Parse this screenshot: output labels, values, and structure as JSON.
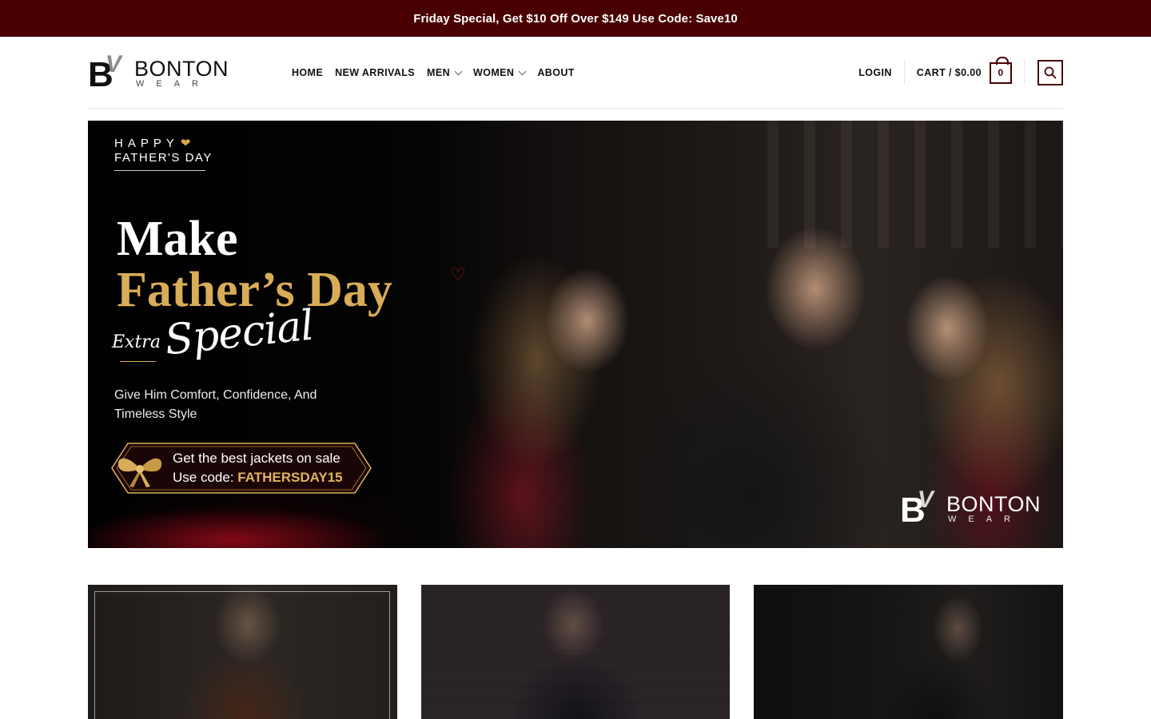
{
  "announcement": {
    "text": "Friday Special, Get $10 Off Over $149 Use Code: Save10"
  },
  "brand": {
    "word": "BONTON",
    "subword": "WEAR",
    "mark_b": "B",
    "mark_v": "V"
  },
  "nav": {
    "items": [
      {
        "label": "HOME",
        "has_dropdown": false
      },
      {
        "label": "NEW ARRIVALS",
        "has_dropdown": false
      },
      {
        "label": "MEN",
        "has_dropdown": true
      },
      {
        "label": "WOMEN",
        "has_dropdown": true
      },
      {
        "label": "ABOUT",
        "has_dropdown": false
      }
    ]
  },
  "header_right": {
    "login_label": "LOGIN",
    "cart_label": "CART / $0.00",
    "cart_count": "0",
    "search_icon": "search-icon"
  },
  "hero": {
    "happy": "HAPPY",
    "fathers_day_small": "FATHER'S DAY",
    "title_line1": "Make",
    "title_line2": "Father’s Day",
    "extra": "Extra",
    "special": "Special",
    "subtitle": "Give Him Comfort, Confidence, And Timeless Style",
    "coupon_line1": "Get the best jackets on sale",
    "coupon_code_label": "Use code:",
    "coupon_code": "FATHERSDAY15"
  },
  "colors": {
    "brand_maroon": "#4a0000",
    "gold": "#d9ac57"
  }
}
